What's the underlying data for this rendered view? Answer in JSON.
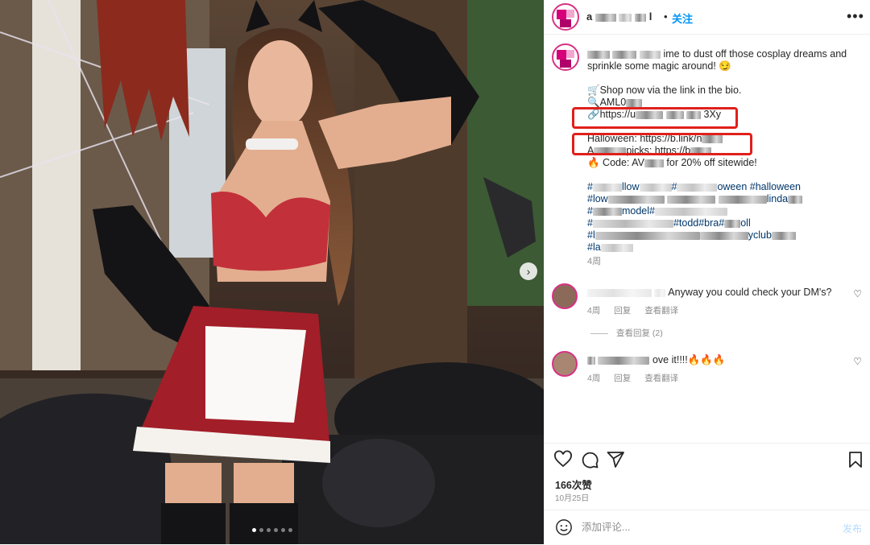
{
  "header": {
    "username_visible": "a",
    "username_tail": "l",
    "separator": "•",
    "follow_label": "关注",
    "more_icon": "more-horizontal-icon"
  },
  "caption": {
    "line1": "ime to dust off those cosplay dreams and",
    "line2": "sprinkle some magic around! 😏",
    "shop": "🛒Shop now via the link in the bio.",
    "search_code": "🔍AML0",
    "link1_prefix": "🔗https://u",
    "link1_suffix": "3Xy",
    "halloween": "Halloween: https://b.link/n",
    "picks_prefix": "A",
    "picks_mid": "picks: https://b",
    "code_prefix": "🔥 Code: AV",
    "code_suffix": "for 20% off sitewide!",
    "tag_row1_a": "#",
    "tag_row1_b": "llow",
    "tag_row1_c": "#",
    "tag_row1_d": "oween #halloween",
    "tag_row2_a": "#l",
    "tag_row2_b": "ow",
    "tag_row2_c": "linda",
    "tag_row3_a": "#",
    "tag_row3_b": "model",
    "tag_row3_c": "#",
    "tag_row4_a": "#",
    "tag_row4_b": "#todd",
    "tag_row4_c": "#bra",
    "tag_row4_d": "#",
    "tag_row4_e": "oll",
    "tag_row5_a": "#l",
    "tag_row5_b": "yclub",
    "tag_row6_a": "#la",
    "time": "4周"
  },
  "comments": [
    {
      "text": "Anyway you could check your DM's?",
      "time": "4周",
      "reply": "回复",
      "translate": "查看翻译"
    },
    {
      "text": "ove it!!!!🔥🔥🔥",
      "time": "4周",
      "reply": "回复",
      "translate": "查看翻译"
    }
  ],
  "view_replies": "查看回复 (2)",
  "actions": {
    "like_icon": "heart-icon",
    "comment_icon": "comment-icon",
    "share_icon": "send-icon",
    "save_icon": "bookmark-icon"
  },
  "likes": "166次赞",
  "date": "10月25日",
  "comment_input": {
    "placeholder": "添加评论...",
    "post_label": "发布"
  },
  "carousel": {
    "slides": 6,
    "active": 1
  },
  "colors": {
    "accent": "#0095f6",
    "highlight": "#e0201b",
    "hashtag": "#00376b"
  }
}
